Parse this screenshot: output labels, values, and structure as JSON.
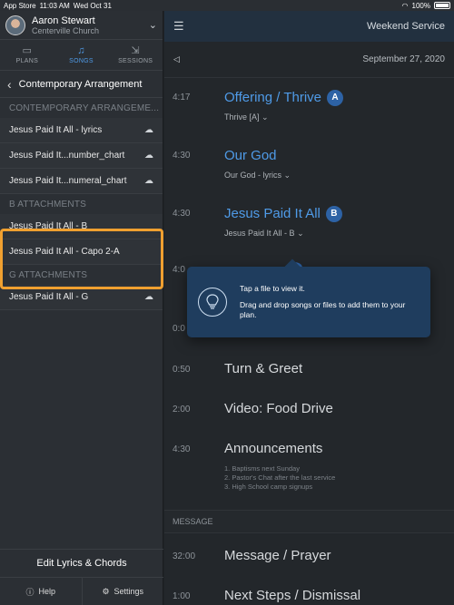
{
  "statusbar": {
    "carrier": "App Store",
    "time": "11:03 AM",
    "date": "Wed Oct 31",
    "battery": "100%"
  },
  "profile": {
    "name": "Aaron Stewart",
    "church": "Centerville Church"
  },
  "nav_tabs": [
    {
      "label": "PLANS",
      "icon": "plans-icon"
    },
    {
      "label": "SONGS",
      "icon": "music-note-icon",
      "active": true
    },
    {
      "label": "SESSIONS",
      "icon": "sessions-icon"
    }
  ],
  "sidebar": {
    "section_title": "Contemporary Arrangement",
    "groups": [
      {
        "label": "CONTEMPORARY ARRANGEME...",
        "files": [
          {
            "name": "Jesus Paid It All - lyrics",
            "cloud": true
          },
          {
            "name": "Jesus Paid It...number_chart",
            "cloud": true
          },
          {
            "name": "Jesus Paid It...numeral_chart",
            "cloud": true
          }
        ]
      },
      {
        "label": "B ATTACHMENTS",
        "files": [
          {
            "name": "Jesus Paid It All - B",
            "cloud": false
          },
          {
            "name": "Jesus Paid It All - Capo 2-A",
            "cloud": false
          }
        ]
      },
      {
        "label": "G ATTACHMENTS",
        "files": [
          {
            "name": "Jesus Paid It All - G",
            "cloud": true
          }
        ]
      }
    ],
    "edit_button": "Edit Lyrics & Chords",
    "help": "Help",
    "settings": "Settings"
  },
  "header": {
    "service": "Weekend Service",
    "date": "September 27, 2020"
  },
  "plan_items": [
    {
      "time": "4:17",
      "title": "Offering / Thrive",
      "badge": "A",
      "sub": "Thrive [A]",
      "style": "blue"
    },
    {
      "time": "4:30",
      "title": "Our God",
      "sub": "Our God - lyrics",
      "style": "blue"
    },
    {
      "time": "4:30",
      "title": "Jesus Paid It All",
      "badge": "B",
      "sub": "Jesus Paid It All - B",
      "style": "blue"
    },
    {
      "time": "4:0",
      "style": "blue"
    },
    {
      "time": "0:0",
      "style": "gray"
    },
    {
      "time": "0:50",
      "title": "Turn & Greet",
      "style": "gray"
    },
    {
      "time": "2:00",
      "title": "Video: Food Drive",
      "style": "gray"
    },
    {
      "time": "4:30",
      "title": "Announcements",
      "style": "gray",
      "notes": [
        "1. Baptisms next Sunday",
        "2. Pastor's Chat after the last service",
        "3. High School camp signups"
      ]
    }
  ],
  "section_label": "MESSAGE",
  "message_items": [
    {
      "time": "32:00",
      "title": "Message / Prayer"
    },
    {
      "time": "1:00",
      "title": "Next Steps / Dismissal"
    }
  ],
  "popover": {
    "line1": "Tap a file to view it.",
    "line2": "Drag and drop songs or files to add them to your plan."
  },
  "colors": {
    "accent": "#4f9be8",
    "highlight": "#f0a030",
    "popover": "#1f3d5e"
  }
}
